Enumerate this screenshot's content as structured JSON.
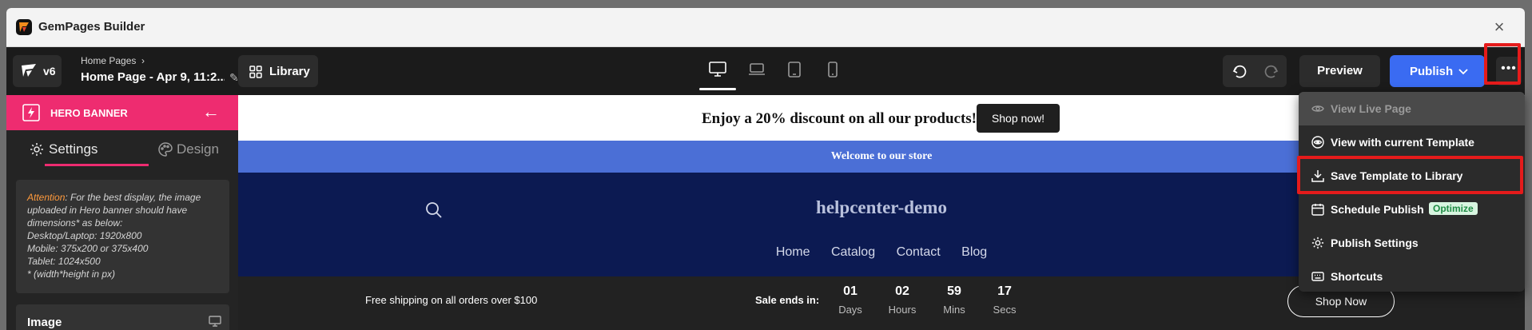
{
  "window": {
    "title": "GemPages Builder",
    "close_label": "×"
  },
  "toolbar": {
    "version": "v6",
    "breadcrumb": "Home Pages",
    "breadcrumb_sep": "›",
    "page_name": "Home Page - Apr 9, 11:2...",
    "library_label": "Library",
    "preview_label": "Preview",
    "publish_label": "Publish",
    "more_label": "•••"
  },
  "sidebar": {
    "section_title": "HERO BANNER",
    "back_label": "←",
    "tabs": [
      {
        "label": "Settings"
      },
      {
        "label": "Design"
      }
    ],
    "notice": {
      "attention": "Attention",
      "line1": ": For the best display, the image uploaded in Hero banner should have dimensions* as below:",
      "line2": "Desktop/Laptop: 1920x800",
      "line3": "Mobile: 375x200 or 375x400",
      "line4": "Tablet: 1024x500",
      "line5": "* (width*height in px)"
    },
    "image_label": "Image"
  },
  "canvas": {
    "promo_text": "Enjoy a 20% discount on all our products!",
    "promo_button": "Shop now!",
    "welcome": "Welcome to our store",
    "store_name": "helpcenter-demo",
    "nav": [
      "Home",
      "Catalog",
      "Contact",
      "Blog"
    ],
    "free_shipping": "Free shipping on all orders over $100",
    "sale_ends": "Sale ends in:",
    "countdown": [
      {
        "num": "01",
        "label": "Days"
      },
      {
        "num": "02",
        "label": "Hours"
      },
      {
        "num": "59",
        "label": "Mins"
      },
      {
        "num": "17",
        "label": "Secs"
      }
    ],
    "shop_now_outline": "Shop Now"
  },
  "menu": {
    "items": [
      {
        "label": "View Live Page"
      },
      {
        "label": "View with current Template"
      },
      {
        "label": "Save Template to Library"
      },
      {
        "label": "Schedule Publish"
      },
      {
        "label": "Publish Settings"
      },
      {
        "label": "Shortcuts"
      }
    ],
    "optimize_badge": "Optimize"
  },
  "colors": {
    "accent_pink": "#ee2c70",
    "publish_blue": "#3a6bf2",
    "welcome_blue": "#4b6fd6",
    "header_navy": "#0c1a52",
    "highlight_red": "#e51b1b"
  }
}
